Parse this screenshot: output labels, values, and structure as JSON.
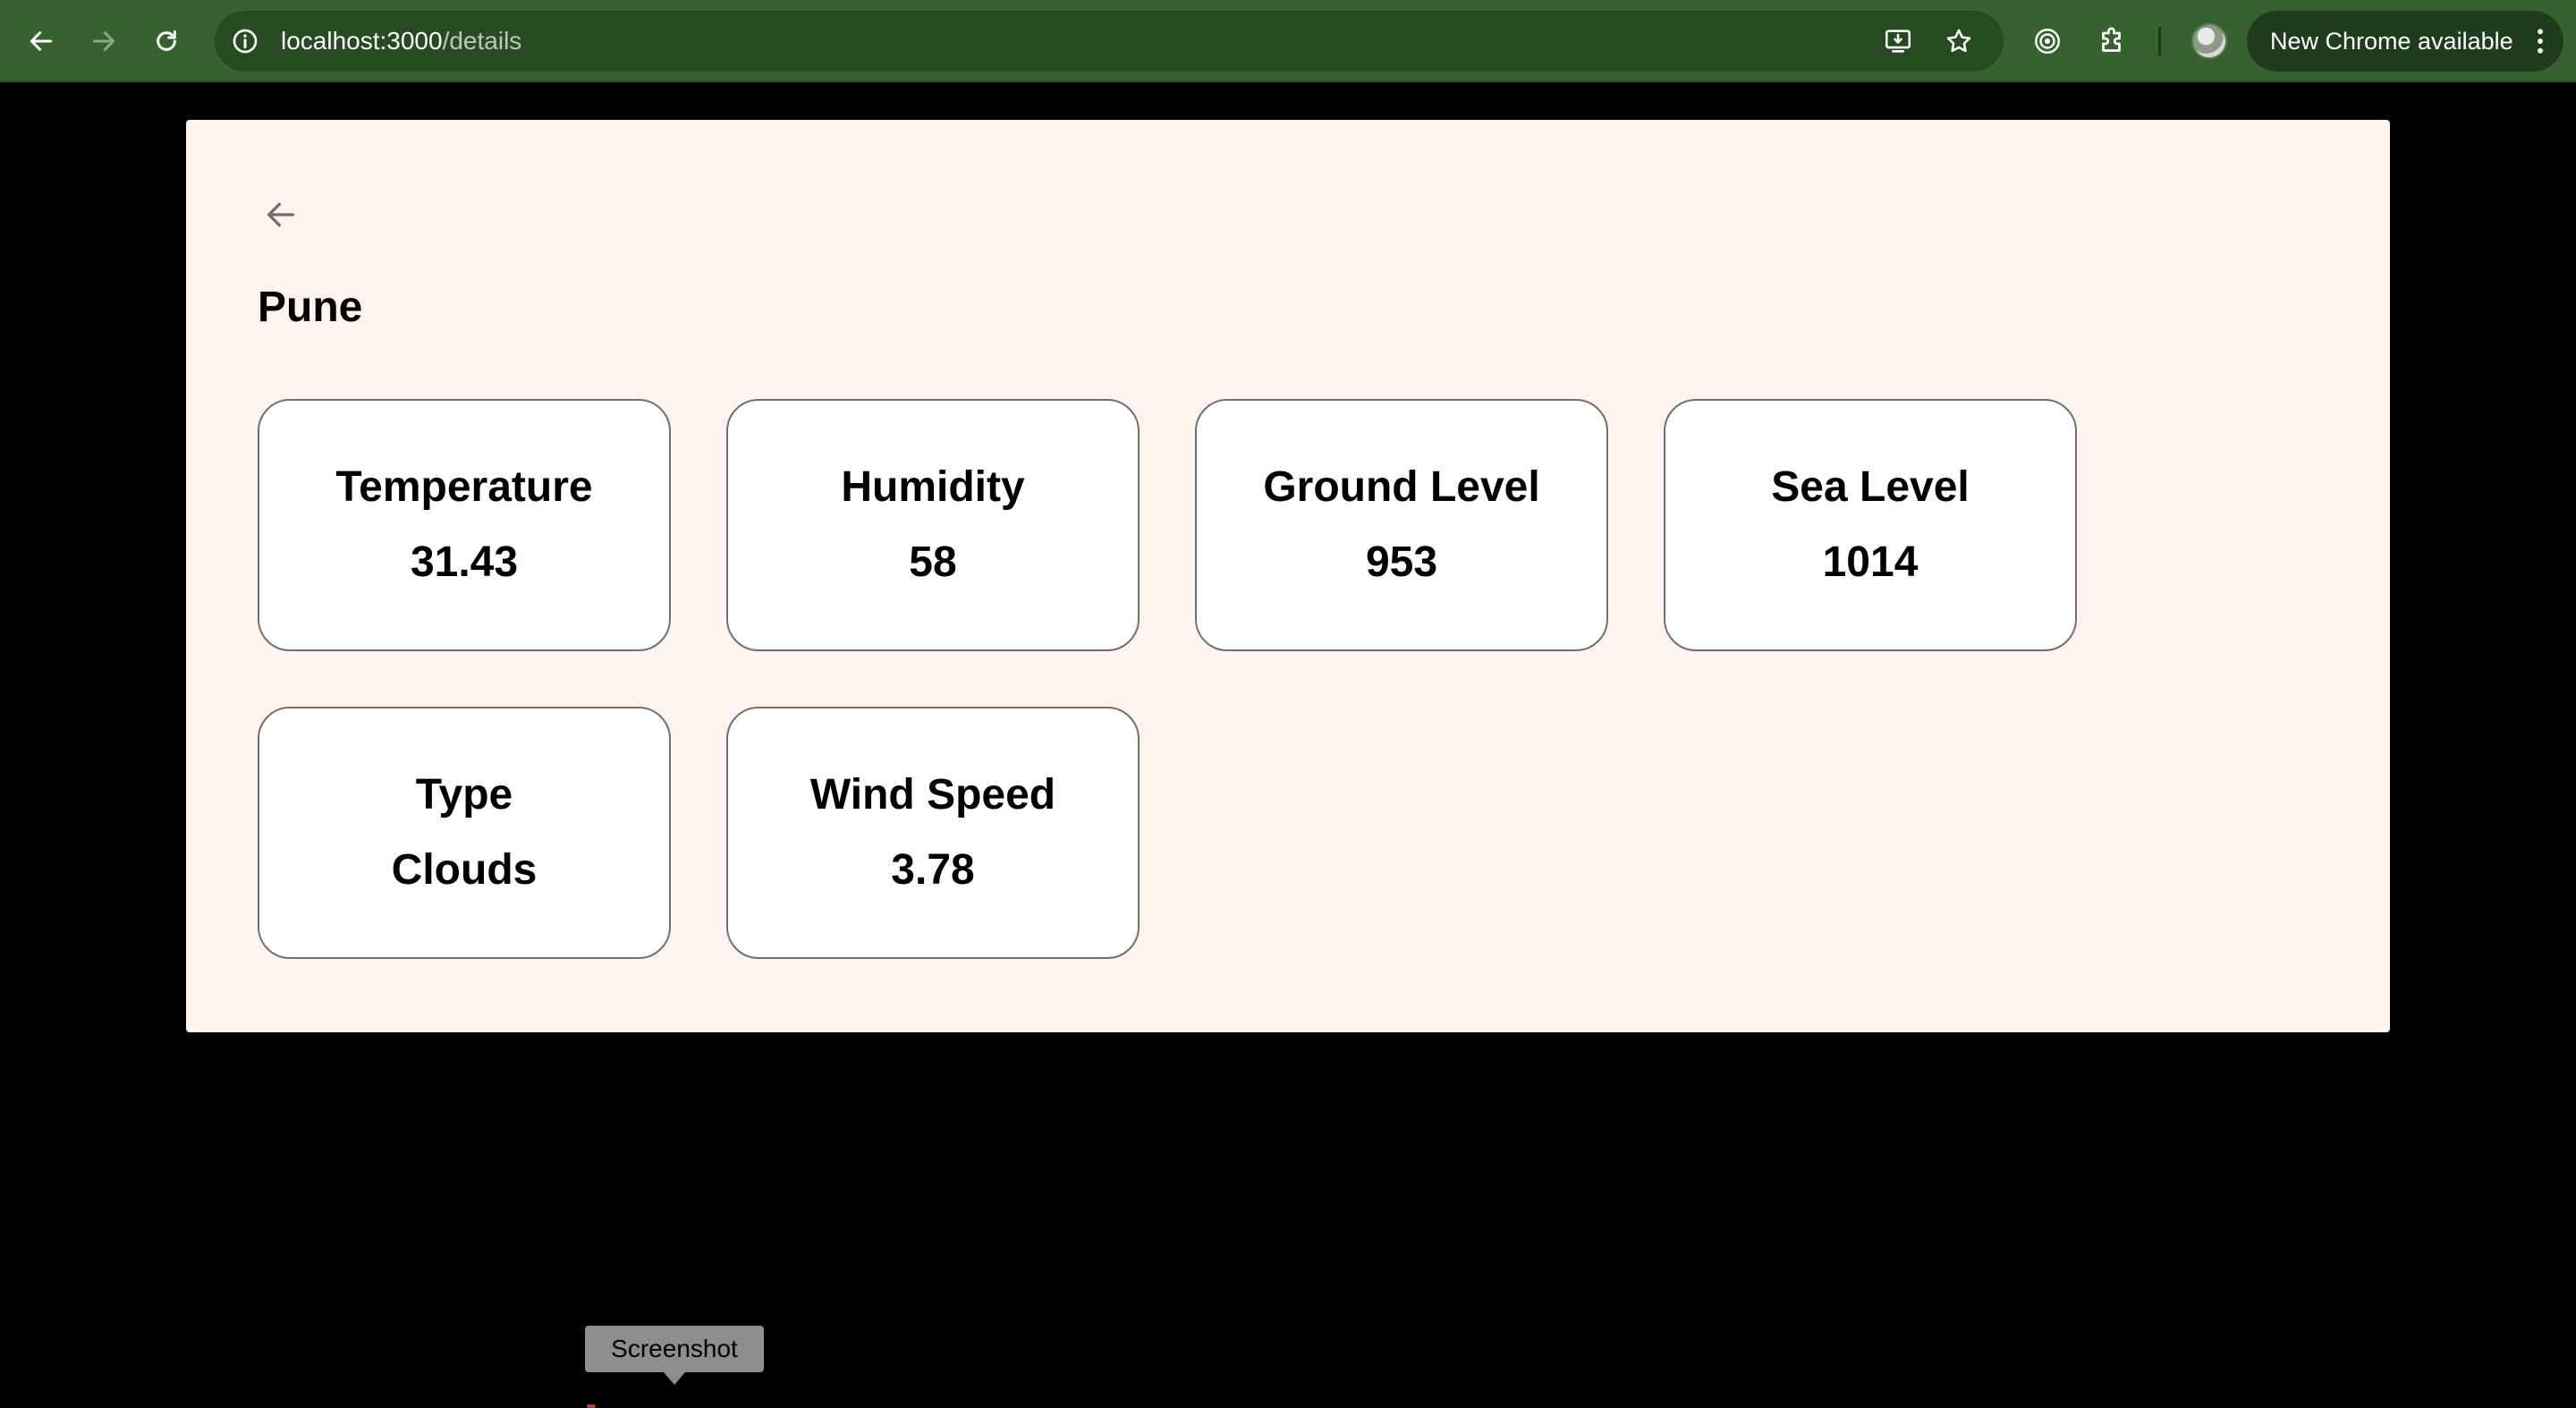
{
  "browser": {
    "url_host": "localhost:3000",
    "url_path": "/details",
    "update_label": "New Chrome available",
    "toolbar_color": "#35622f"
  },
  "page": {
    "city": "Pune",
    "background_color": "#fdf3ef",
    "stats": [
      {
        "label": "Temperature",
        "value": "31.43"
      },
      {
        "label": "Humidity",
        "value": "58"
      },
      {
        "label": "Ground Level",
        "value": "953"
      },
      {
        "label": "Sea Level",
        "value": "1014"
      },
      {
        "label": "Type",
        "value": "Clouds"
      },
      {
        "label": "Wind Speed",
        "value": "3.78"
      }
    ]
  },
  "overlay": {
    "tooltip_text": "Screenshot"
  }
}
